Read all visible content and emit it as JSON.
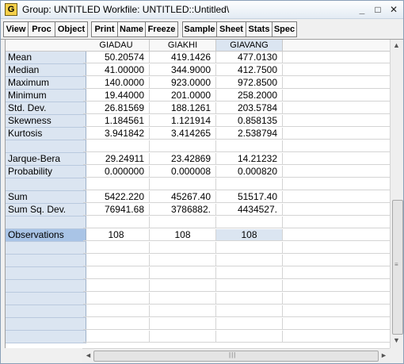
{
  "window": {
    "icon_letter": "G",
    "title": "Group: UNTITLED   Workfile: UNTITLED::Untitled\\"
  },
  "title_buttons": {
    "minimize": "_",
    "maximize": "□",
    "close": "✕"
  },
  "toolbar": {
    "buttons": [
      "View",
      "Proc",
      "Object",
      "Print",
      "Name",
      "Freeze",
      "Sample",
      "Sheet",
      "Stats",
      "Spec"
    ]
  },
  "table": {
    "columns": [
      "GIADAU",
      "GIAKHI",
      "GIAVANG"
    ],
    "rows": [
      {
        "label": "Mean",
        "values": [
          "50.20574",
          "419.1426",
          "477.0130"
        ]
      },
      {
        "label": "Median",
        "values": [
          "41.00000",
          "344.9000",
          "412.7500"
        ]
      },
      {
        "label": "Maximum",
        "values": [
          "140.0000",
          "923.0000",
          "972.8500"
        ]
      },
      {
        "label": "Minimum",
        "values": [
          "19.44000",
          "201.0000",
          "258.2000"
        ]
      },
      {
        "label": "Std. Dev.",
        "values": [
          "26.81569",
          "188.1261",
          "203.5784"
        ]
      },
      {
        "label": "Skewness",
        "values": [
          "1.184561",
          "1.121914",
          "0.858135"
        ]
      },
      {
        "label": "Kurtosis",
        "values": [
          "3.941842",
          "3.414265",
          "2.538794"
        ]
      },
      {
        "label": "",
        "values": [
          "",
          "",
          ""
        ]
      },
      {
        "label": "Jarque-Bera",
        "values": [
          "29.24911",
          "23.42869",
          "14.21232"
        ]
      },
      {
        "label": "Probability",
        "values": [
          "0.000000",
          "0.000008",
          "0.000820"
        ]
      },
      {
        "label": "",
        "values": [
          "",
          "",
          ""
        ]
      },
      {
        "label": "Sum",
        "values": [
          "5422.220",
          "45267.40",
          "51517.40"
        ]
      },
      {
        "label": "Sum Sq. Dev.",
        "values": [
          "76941.68",
          "3786882.",
          "4434527."
        ]
      },
      {
        "label": "",
        "values": [
          "",
          "",
          ""
        ]
      },
      {
        "label": "Observations",
        "values": [
          "108",
          "108",
          "108"
        ]
      }
    ],
    "empty_rows": 8
  },
  "scrollbars": {
    "up": "▲",
    "down": "▼",
    "left": "◄",
    "right": "►",
    "grip_v": "≡",
    "grip_h": "|||"
  }
}
